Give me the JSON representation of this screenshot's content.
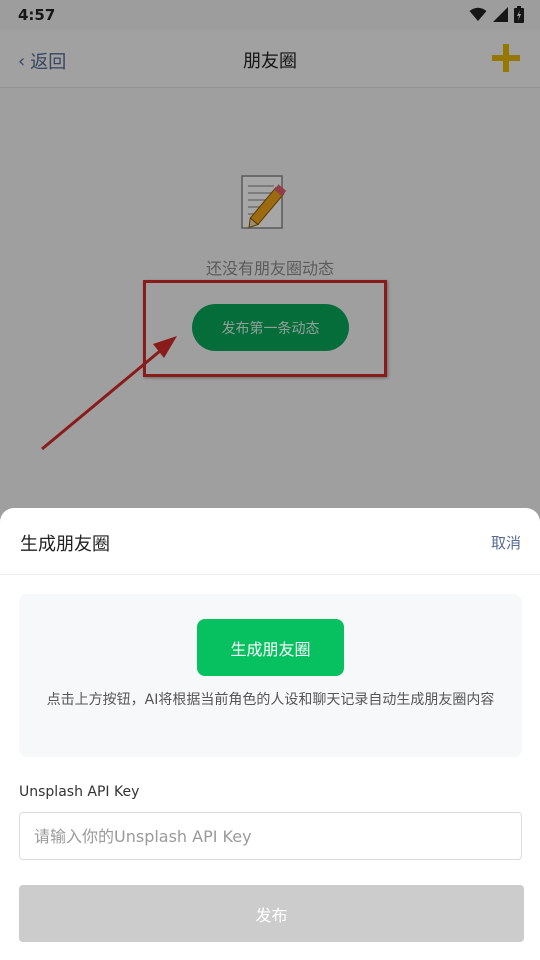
{
  "status_bar": {
    "time": "4:57"
  },
  "nav": {
    "back_label": "返回",
    "title": "朋友圈"
  },
  "empty_state": {
    "message": "还没有朋友圈动态",
    "first_post_label": "发布第一条动态"
  },
  "sheet": {
    "title": "生成朋友圈",
    "cancel_label": "取消",
    "generate_label": "生成朋友圈",
    "description": "点击上方按钮，AI将根据当前角色的人设和聊天记录自动生成朋友圈内容",
    "api_label": "Unsplash API Key",
    "api_placeholder": "请输入你的Unsplash API Key",
    "publish_label": "发布"
  },
  "colors": {
    "accent_green": "#07c160",
    "link_blue": "#576b95",
    "add_icon_yellow": "#e6b800",
    "annotation_red": "#d42a2a",
    "disabled_gray": "#cccccc"
  },
  "icons": [
    "wifi-icon",
    "signal-icon",
    "battery-icon",
    "chevron-left-icon",
    "plus-icon",
    "notepad-pencil-icon"
  ]
}
